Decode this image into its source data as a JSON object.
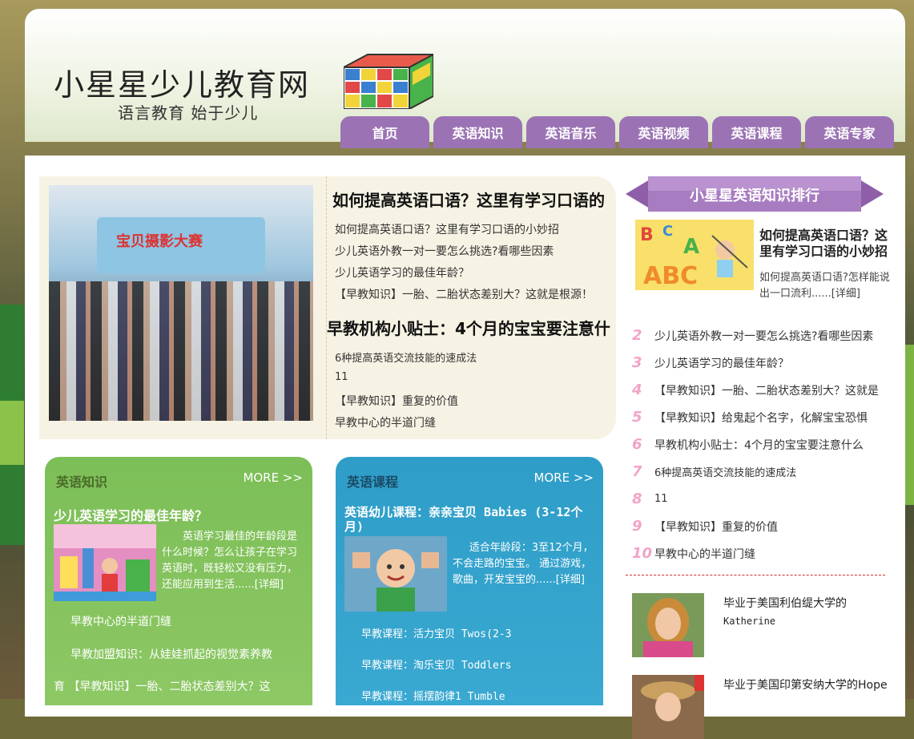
{
  "site": {
    "logo_title": "小星星少儿教育网",
    "logo_subtitle": "语言教育 始于少儿"
  },
  "nav": [
    {
      "label": "首页"
    },
    {
      "label": "英语知识"
    },
    {
      "label": "英语音乐"
    },
    {
      "label": "英语视频"
    },
    {
      "label": "英语课程"
    },
    {
      "label": "英语专家"
    }
  ],
  "feature": {
    "photo_banner": "宝贝摄影大赛",
    "title1": "如何提高英语口语？这里有学习口语的",
    "links1": [
      "如何提高英语口语？这里有学习口语的小妙招",
      "少儿英语外教一对一要怎么挑选?看哪些因素",
      "少儿英语学习的最佳年龄？",
      "【早教知识】一胎、二胎状态差别大？这就是根源！"
    ],
    "title2": "早教机构小贴士：4个月的宝宝要注意什",
    "links2": [
      "6种提高英语交流技能的速成法",
      "11",
      "【早教知识】重复的价值",
      "早教中心的半道门缝"
    ]
  },
  "knowledge_card": {
    "heading": "英语知识",
    "more": "MORE >>",
    "title": "少儿英语学习的最佳年龄？",
    "desc": "英语学习最佳的年龄段是什么时候？怎么让孩子在学习英语时，既轻松又没有压力，还能应用到生活......[详细]",
    "links": [
      "早教中心的半道门缝",
      "早教加盟知识：从娃娃抓起的视觉素养教",
      "育 【早教知识】一胎、二胎状态差别大？这"
    ]
  },
  "course_card": {
    "heading": "英语课程",
    "more": "MORE >>",
    "title": "英语幼儿课程：亲亲宝贝 Babies (3-12个月)",
    "desc": "适合年龄段：3至12个月，不会走路的宝宝。 通过游戏，歌曲，开发宝宝的......[详细]",
    "links": [
      "早教课程：活力宝贝 Twos(2-3",
      "早教课程：淘乐宝贝 Toddlers",
      "早教课程：摇摆韵律1 Tumble"
    ]
  },
  "ranking": {
    "banner": "小星星英语知识排行",
    "top_title": "如何提高英语口语？这里有学习口语的小妙招",
    "top_desc": "如何提高英语口语?怎样能说出一口流利......[详细]",
    "items": [
      {
        "num": "2",
        "text": "少儿英语外教一对一要怎么挑选?看哪些因素"
      },
      {
        "num": "3",
        "text": "少儿英语学习的最佳年龄？"
      },
      {
        "num": "4",
        "text": "【早教知识】一胎、二胎状态差别大？这就是"
      },
      {
        "num": "5",
        "text": "【早教知识】给鬼起个名字，化解宝宝恐惧"
      },
      {
        "num": "6",
        "text": "早教机构小贴士：4个月的宝宝要注意什么"
      },
      {
        "num": "7",
        "text": "6种提高英语交流技能的速成法"
      },
      {
        "num": "8",
        "text": "11"
      },
      {
        "num": "9",
        "text": "【早教知识】重复的价值"
      },
      {
        "num": "10",
        "text": "早教中心的半道门缝"
      }
    ]
  },
  "experts": [
    {
      "line1": "毕业于美国利伯缇大学的",
      "line2": "Katherine"
    },
    {
      "line1": "毕业于美国印第安纳大学的Hope",
      "line2": ""
    }
  ]
}
